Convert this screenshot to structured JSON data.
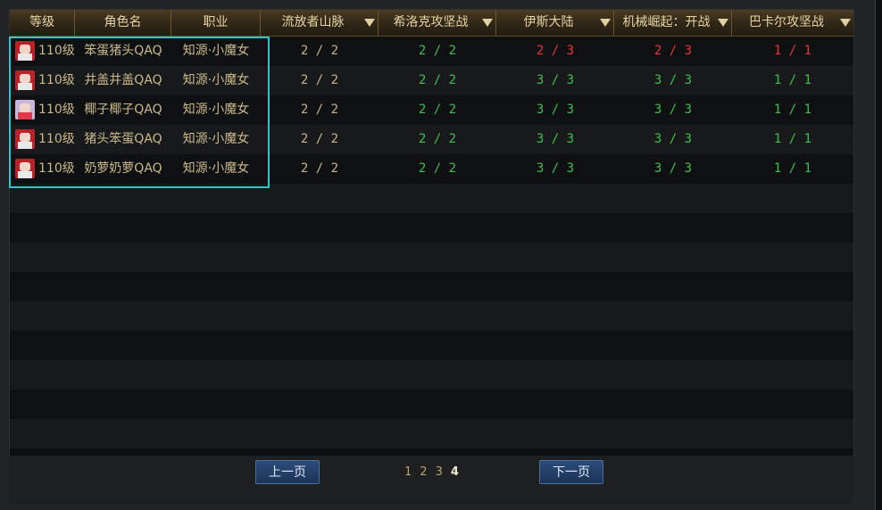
{
  "table": {
    "headers": [
      {
        "label": "等级",
        "dropdown": false
      },
      {
        "label": "角色名",
        "dropdown": false
      },
      {
        "label": "职业",
        "dropdown": false
      },
      {
        "label": "流放者山脉",
        "dropdown": true
      },
      {
        "label": "希洛克攻坚战",
        "dropdown": true
      },
      {
        "label": "伊斯大陆",
        "dropdown": true
      },
      {
        "label": "机械崛起：开战",
        "dropdown": true
      },
      {
        "label": "巴卡尔攻坚战",
        "dropdown": true
      }
    ],
    "rows": [
      {
        "level": "110级",
        "name": "笨蛋猪头QAQ",
        "class": "知源·小魔女",
        "avatar": "red",
        "c1": "2 / 2",
        "c2": "2 / 2",
        "c3": "2 / 3",
        "c4": "2 / 3",
        "c5": "1 / 1",
        "c3_color": "red",
        "c4_color": "red",
        "c5_color": "red"
      },
      {
        "level": "110级",
        "name": "井盖井盖QAQ",
        "class": "知源·小魔女",
        "avatar": "red",
        "c1": "2 / 2",
        "c2": "2 / 2",
        "c3": "3 / 3",
        "c4": "3 / 3",
        "c5": "1 / 1",
        "c3_color": "green",
        "c4_color": "green",
        "c5_color": "green"
      },
      {
        "level": "110级",
        "name": "椰子椰子QAQ",
        "class": "知源·小魔女",
        "avatar": "alt",
        "c1": "2 / 2",
        "c2": "2 / 2",
        "c3": "3 / 3",
        "c4": "3 / 3",
        "c5": "1 / 1",
        "c3_color": "green",
        "c4_color": "green",
        "c5_color": "green"
      },
      {
        "level": "110级",
        "name": "猪头笨蛋QAQ",
        "class": "知源·小魔女",
        "avatar": "red",
        "c1": "2 / 2",
        "c2": "2 / 2",
        "c3": "3 / 3",
        "c4": "3 / 3",
        "c5": "1 / 1",
        "c3_color": "green",
        "c4_color": "green",
        "c5_color": "green"
      },
      {
        "level": "110级",
        "name": "奶萝奶萝QAQ",
        "class": "知源·小魔女",
        "avatar": "red",
        "c1": "2 / 2",
        "c2": "2 / 2",
        "c3": "3 / 3",
        "c4": "3 / 3",
        "c5": "1 / 1",
        "c3_color": "green",
        "c4_color": "green",
        "c5_color": "green"
      }
    ],
    "colors": {
      "green": "#3fbf50",
      "red": "#e23a3a",
      "beige": "#c4b48a",
      "highlight": "#2ec7c9"
    }
  },
  "pagination": {
    "prev_label": "上一页",
    "next_label": "下一页",
    "pages": [
      "1",
      "2",
      "3",
      "4"
    ],
    "current": "4"
  }
}
